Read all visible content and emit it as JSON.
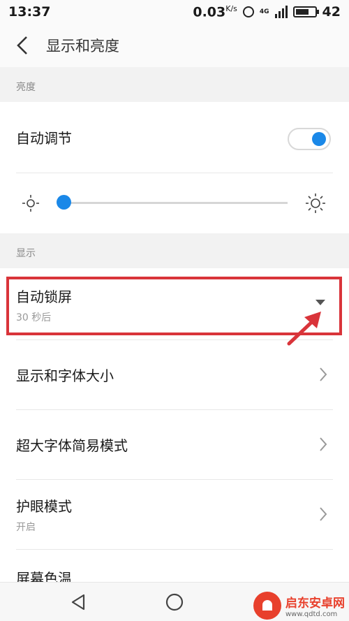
{
  "status_bar": {
    "time": "13:37",
    "speed": "0.03",
    "speed_unit": "K/s",
    "network": "4G",
    "battery": "42"
  },
  "app_bar": {
    "title": "显示和亮度"
  },
  "brightness": {
    "section_label": "亮度",
    "auto_adjust_label": "自动调节",
    "auto_adjust_on": true,
    "slider_value": 0.03
  },
  "display": {
    "section_label": "显示",
    "items": [
      {
        "label": "自动锁屏",
        "value": "30 秒后"
      },
      {
        "label": "显示和字体大小"
      },
      {
        "label": "超大字体简易模式"
      },
      {
        "label": "护眼模式",
        "value": "开启"
      },
      {
        "label": "屏幕色温"
      }
    ]
  },
  "colors": {
    "accent": "#1a88e8",
    "highlight": "#d9343a"
  },
  "watermark": {
    "title": "启东安卓网",
    "url": "www.qdtd.com"
  }
}
